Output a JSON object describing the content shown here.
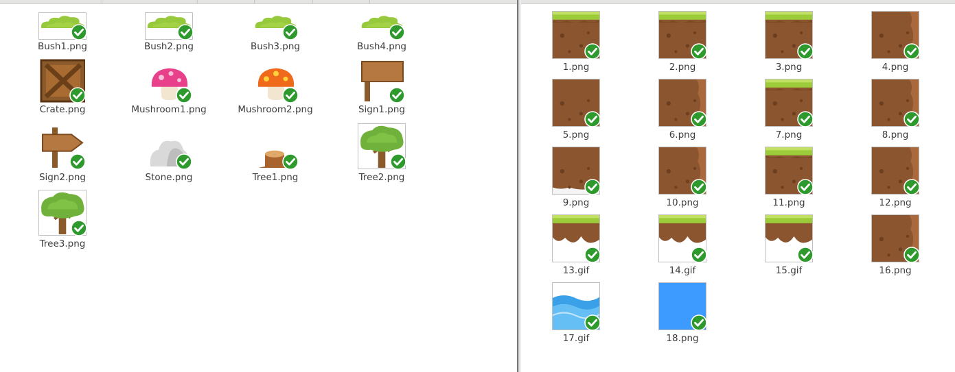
{
  "left_window": {
    "files": [
      {
        "name": "Bush1.png",
        "icon": "bush-icon",
        "framed": true
      },
      {
        "name": "Bush2.png",
        "icon": "bush-icon",
        "framed": true
      },
      {
        "name": "Bush3.png",
        "icon": "bush-icon",
        "framed": false
      },
      {
        "name": "Bush4.png",
        "icon": "bush-icon",
        "framed": false
      },
      {
        "name": "Crate.png",
        "icon": "crate-icon",
        "framed": false
      },
      {
        "name": "Mushroom1.png",
        "icon": "mushroom-pink-icon",
        "framed": false
      },
      {
        "name": "Mushroom2.png",
        "icon": "mushroom-orange-icon",
        "framed": false
      },
      {
        "name": "Sign1.png",
        "icon": "signboard-icon",
        "framed": false
      },
      {
        "name": "Sign2.png",
        "icon": "arrow-sign-icon",
        "framed": false
      },
      {
        "name": "Stone.png",
        "icon": "stone-icon",
        "framed": false
      },
      {
        "name": "Tree1.png",
        "icon": "tree-stump-icon",
        "framed": false
      },
      {
        "name": "Tree2.png",
        "icon": "tree-icon",
        "framed": true
      },
      {
        "name": "Tree3.png",
        "icon": "tree-icon",
        "framed": true
      }
    ]
  },
  "right_window": {
    "files": [
      {
        "name": "1.png",
        "icon": "ground-tile-grass-icon"
      },
      {
        "name": "2.png",
        "icon": "ground-tile-grass-icon"
      },
      {
        "name": "3.png",
        "icon": "ground-tile-grass-icon"
      },
      {
        "name": "4.png",
        "icon": "ground-tile-edge-icon"
      },
      {
        "name": "5.png",
        "icon": "ground-tile-dirt-icon"
      },
      {
        "name": "6.png",
        "icon": "ground-tile-edge-icon"
      },
      {
        "name": "7.png",
        "icon": "ground-tile-grass-icon"
      },
      {
        "name": "8.png",
        "icon": "ground-tile-edge-icon"
      },
      {
        "name": "9.png",
        "icon": "ground-tile-bottom-icon"
      },
      {
        "name": "10.png",
        "icon": "ground-tile-edge-icon"
      },
      {
        "name": "11.png",
        "icon": "ground-tile-grass-icon"
      },
      {
        "name": "12.png",
        "icon": "ground-tile-edge-icon"
      },
      {
        "name": "13.gif",
        "icon": "floating-ledge-icon"
      },
      {
        "name": "14.gif",
        "icon": "floating-ledge-icon"
      },
      {
        "name": "15.gif",
        "icon": "floating-ledge-icon"
      },
      {
        "name": "16.png",
        "icon": "ground-tile-edge-icon"
      },
      {
        "name": "17.gif",
        "icon": "water-tile-icon"
      },
      {
        "name": "18.png",
        "icon": "blue-tile-icon"
      }
    ]
  },
  "emblem": {
    "icon": "synced-checkmark-emblem-icon",
    "color": "#2e9a2e"
  },
  "colors": {
    "grass": "#9ccc3a",
    "dirt": "#8b5530",
    "water": "#3aa0e8",
    "tile_blue": "#3d9bff"
  }
}
